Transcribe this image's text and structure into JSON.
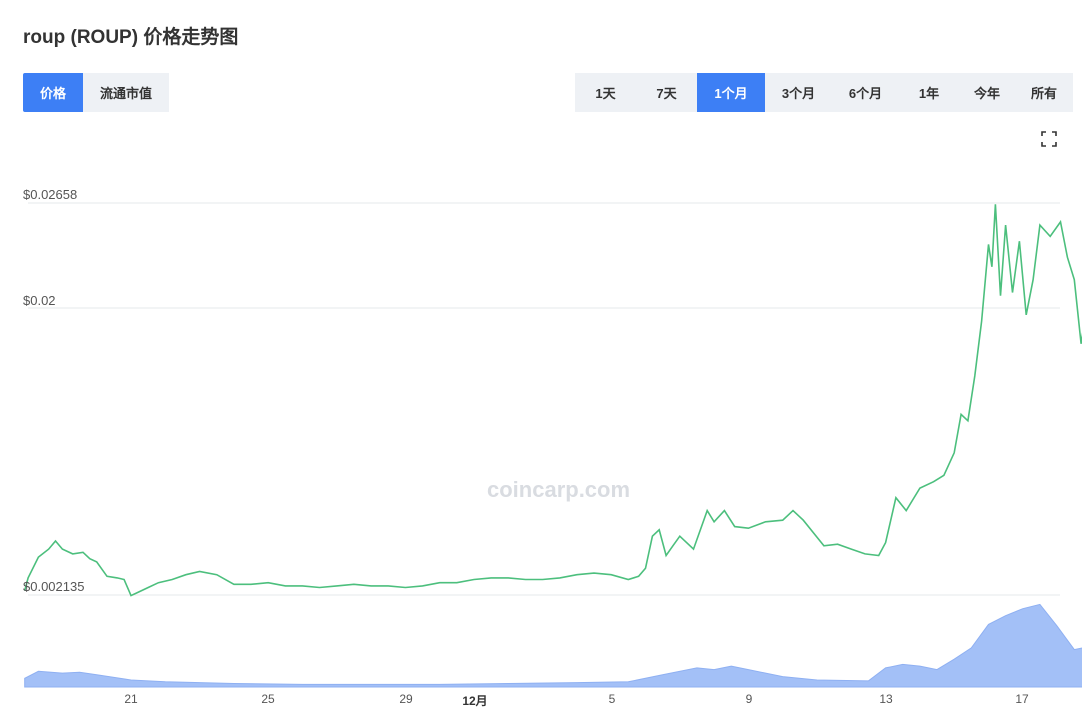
{
  "title": "roup (ROUP) 价格走势图",
  "metric_tabs": [
    {
      "label": "价格",
      "active": true
    },
    {
      "label": "流通市值",
      "active": false
    }
  ],
  "range_tabs": [
    {
      "label": "1天",
      "active": false
    },
    {
      "label": "7天",
      "active": false
    },
    {
      "label": "1个月",
      "active": true
    },
    {
      "label": "3个月",
      "active": false
    },
    {
      "label": "6个月",
      "active": false
    },
    {
      "label": "1年",
      "active": false
    },
    {
      "label": "今年",
      "active": false
    },
    {
      "label": "所有",
      "active": false
    }
  ],
  "watermark": "coincarp.com",
  "colors": {
    "accent": "#3d7ff5",
    "price_line": "#4cbf7d",
    "volume_fill": "#a3c0f7"
  },
  "icons": {
    "fullscreen": "fullscreen-icon"
  },
  "chart_data": {
    "type": "line",
    "ytick_labels": [
      "$0.02658",
      "$0.02",
      "$0.002135"
    ],
    "xtick_labels": [
      "21",
      "25",
      "29",
      "12月",
      "5",
      "9",
      "13",
      "17"
    ],
    "price_series": [
      [
        17.9,
        0.0024
      ],
      [
        18.0,
        0.0032
      ],
      [
        18.3,
        0.0045
      ],
      [
        18.6,
        0.005
      ],
      [
        18.8,
        0.0055
      ],
      [
        19.0,
        0.005
      ],
      [
        19.3,
        0.0047
      ],
      [
        19.6,
        0.0048
      ],
      [
        19.8,
        0.0044
      ],
      [
        20.0,
        0.0042
      ],
      [
        20.3,
        0.0033
      ],
      [
        20.6,
        0.0032
      ],
      [
        20.8,
        0.0031
      ],
      [
        21.0,
        0.0021
      ],
      [
        21.2,
        0.0023
      ],
      [
        21.5,
        0.0026
      ],
      [
        21.8,
        0.0029
      ],
      [
        22.2,
        0.0031
      ],
      [
        22.6,
        0.0034
      ],
      [
        23.0,
        0.0036
      ],
      [
        23.5,
        0.0034
      ],
      [
        24.0,
        0.0028
      ],
      [
        24.5,
        0.0028
      ],
      [
        25.0,
        0.0029
      ],
      [
        25.5,
        0.0027
      ],
      [
        26.0,
        0.0027
      ],
      [
        26.5,
        0.0026
      ],
      [
        27.0,
        0.0027
      ],
      [
        27.5,
        0.0028
      ],
      [
        28.0,
        0.0027
      ],
      [
        28.5,
        0.0027
      ],
      [
        29.0,
        0.0026
      ],
      [
        29.5,
        0.0027
      ],
      [
        30.0,
        0.0029
      ],
      [
        30.5,
        0.0029
      ],
      [
        31.0,
        0.0031
      ],
      [
        31.5,
        0.0032
      ],
      [
        32.0,
        0.0032
      ],
      [
        32.5,
        0.0031
      ],
      [
        33.0,
        0.0031
      ],
      [
        33.5,
        0.0032
      ],
      [
        34.0,
        0.0034
      ],
      [
        34.5,
        0.0035
      ],
      [
        35.0,
        0.0034
      ],
      [
        35.5,
        0.0031
      ],
      [
        35.8,
        0.0033
      ],
      [
        36.0,
        0.0038
      ],
      [
        36.2,
        0.0058
      ],
      [
        36.4,
        0.0062
      ],
      [
        36.6,
        0.0046
      ],
      [
        36.8,
        0.0052
      ],
      [
        37.0,
        0.0058
      ],
      [
        37.4,
        0.005
      ],
      [
        37.8,
        0.0074
      ],
      [
        38.0,
        0.0067
      ],
      [
        38.3,
        0.0074
      ],
      [
        38.6,
        0.0064
      ],
      [
        39.0,
        0.0063
      ],
      [
        39.5,
        0.0067
      ],
      [
        40.0,
        0.0068
      ],
      [
        40.3,
        0.0074
      ],
      [
        40.6,
        0.0068
      ],
      [
        40.9,
        0.006
      ],
      [
        41.2,
        0.0052
      ],
      [
        41.6,
        0.0053
      ],
      [
        42.0,
        0.005
      ],
      [
        42.4,
        0.0047
      ],
      [
        42.8,
        0.0046
      ],
      [
        43.0,
        0.0054
      ],
      [
        43.3,
        0.0082
      ],
      [
        43.6,
        0.0074
      ],
      [
        44.0,
        0.0088
      ],
      [
        44.4,
        0.0092
      ],
      [
        44.7,
        0.0096
      ],
      [
        45.0,
        0.011
      ],
      [
        45.2,
        0.0134
      ],
      [
        45.4,
        0.013
      ],
      [
        45.6,
        0.0158
      ],
      [
        45.8,
        0.0192
      ],
      [
        46.0,
        0.024
      ],
      [
        46.1,
        0.0226
      ],
      [
        46.2,
        0.0265
      ],
      [
        46.35,
        0.0208
      ],
      [
        46.5,
        0.0252
      ],
      [
        46.7,
        0.021
      ],
      [
        46.9,
        0.0242
      ],
      [
        47.1,
        0.0196
      ],
      [
        47.3,
        0.0218
      ],
      [
        47.5,
        0.0252
      ],
      [
        47.8,
        0.0245
      ],
      [
        48.1,
        0.0254
      ],
      [
        48.3,
        0.0232
      ],
      [
        48.5,
        0.0218
      ],
      [
        48.7,
        0.0178
      ],
      [
        48.85,
        0.02
      ],
      [
        49.0,
        0.0194
      ]
    ],
    "volume_series": [
      [
        17.9,
        0.1
      ],
      [
        18.3,
        0.18
      ],
      [
        19.0,
        0.16
      ],
      [
        19.5,
        0.17
      ],
      [
        20.0,
        0.14
      ],
      [
        21.0,
        0.08
      ],
      [
        22.0,
        0.06
      ],
      [
        24.0,
        0.04
      ],
      [
        26.0,
        0.03
      ],
      [
        28.0,
        0.03
      ],
      [
        30.0,
        0.03
      ],
      [
        32.0,
        0.04
      ],
      [
        34.0,
        0.05
      ],
      [
        35.5,
        0.06
      ],
      [
        36.5,
        0.14
      ],
      [
        37.5,
        0.22
      ],
      [
        38.0,
        0.2
      ],
      [
        38.5,
        0.24
      ],
      [
        39.0,
        0.2
      ],
      [
        40.0,
        0.12
      ],
      [
        41.0,
        0.08
      ],
      [
        42.5,
        0.07
      ],
      [
        43.0,
        0.22
      ],
      [
        43.5,
        0.26
      ],
      [
        44.0,
        0.24
      ],
      [
        44.5,
        0.2
      ],
      [
        45.0,
        0.32
      ],
      [
        45.5,
        0.45
      ],
      [
        46.0,
        0.72
      ],
      [
        46.5,
        0.82
      ],
      [
        47.0,
        0.9
      ],
      [
        47.5,
        0.95
      ],
      [
        48.0,
        0.7
      ],
      [
        48.5,
        0.43
      ],
      [
        49.0,
        0.47
      ]
    ]
  }
}
